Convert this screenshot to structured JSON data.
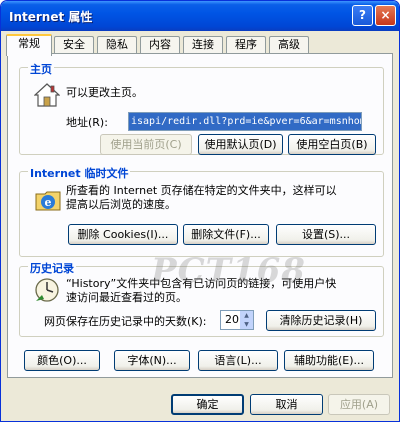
{
  "window": {
    "title": "Internet 属性",
    "help_label": "?",
    "close_label": "×"
  },
  "tabs": [
    "常规",
    "安全",
    "隐私",
    "内容",
    "连接",
    "程序",
    "高级"
  ],
  "home": {
    "group_title": "主页",
    "description": "可以更改主页。",
    "address_label": "地址(R):",
    "address_value": "isapi/redir.dll?prd=ie&pver=6&ar=msnhome",
    "use_current": "使用当前页(C)",
    "use_default": "使用默认页(D)",
    "use_blank": "使用空白页(B)"
  },
  "temp_files": {
    "group_title": "Internet 临时文件",
    "description_line1": "所查看的 Internet 页存储在特定的文件夹中，这样可以",
    "description_line2": "提高以后浏览的速度。",
    "delete_cookies": "删除 Cookies(I)...",
    "delete_files": "删除文件(F)...",
    "settings": "设置(S)..."
  },
  "history": {
    "group_title": "历史记录",
    "description_line1": "“History”文件夹中包含有已访问页的链接，可使用户快",
    "description_line2": "速访问最近查看过的页。",
    "days_label": "网页保存在历史记录中的天数(K):",
    "days_value": "20",
    "clear": "清除历史记录(H)"
  },
  "bottom_buttons": {
    "colors": "颜色(O)...",
    "fonts": "字体(N)...",
    "languages": "语言(L)...",
    "accessibility": "辅助功能(E)..."
  },
  "dialog_buttons": {
    "ok": "确定",
    "cancel": "取消",
    "apply": "应用(A)"
  },
  "watermark": "PCT168"
}
